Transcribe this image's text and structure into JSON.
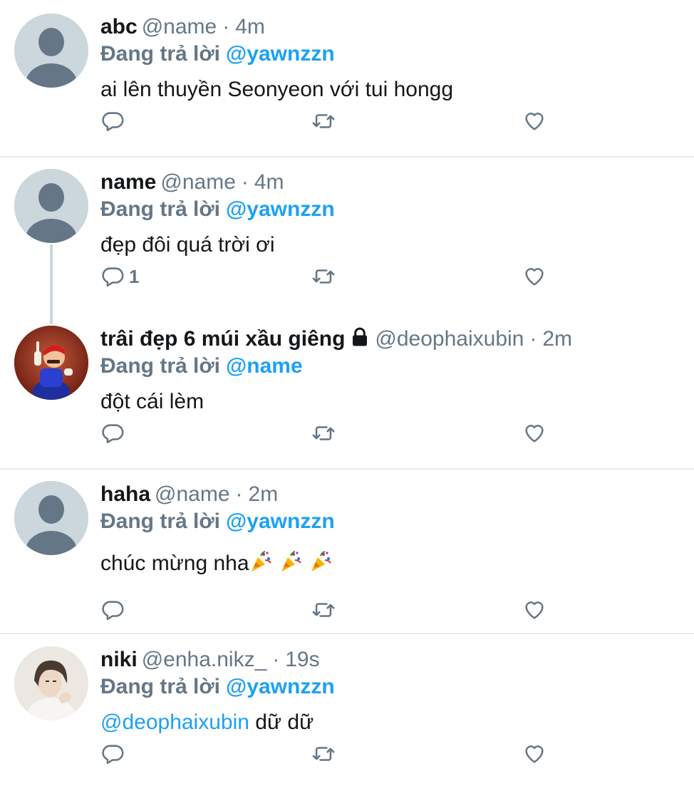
{
  "colors": {
    "link": "#1da1f2",
    "muted": "#657786",
    "divider": "#e6ecf0"
  },
  "tweets": [
    {
      "name": "abc",
      "handle": "@name",
      "sep": "·",
      "time": "4m",
      "replying_prefix": "Đang trả lời",
      "replying_to": "@yawnzzn",
      "text": "ai lên thuyền Seonyeon với tui hongg",
      "reply_count": "",
      "avatar": "default-avatar"
    },
    {
      "name": "name",
      "handle": "@name",
      "sep": "·",
      "time": "4m",
      "replying_prefix": "Đang trả lời",
      "replying_to": "@yawnzzn",
      "text": "đẹp đôi quá trời ơi",
      "reply_count": "1",
      "avatar": "default-avatar"
    },
    {
      "name": "trâi đẹp 6 múi xầu giêng",
      "handle": "@deophaixubin",
      "sep": "·",
      "time": "2m",
      "replying_prefix": "Đang trả lời",
      "replying_to": "@name",
      "text": "đột cái lèm",
      "reply_count": "",
      "avatar": "mario-photo",
      "icon": "lock-icon"
    },
    {
      "name": "haha",
      "handle": "@name",
      "sep": "·",
      "time": "2m",
      "replying_prefix": "Đang trả lời",
      "replying_to": "@yawnzzn",
      "text": "chúc mừng nha",
      "text_emoji": "party-popper-icon x3",
      "reply_count": "",
      "avatar": "default-avatar"
    },
    {
      "name": "niki",
      "handle": "@enha.nikz_",
      "sep": "·",
      "time": "19s",
      "replying_prefix": "Đang trả lời",
      "replying_to": "@yawnzzn",
      "text_mention": "@deophaixubin",
      "text": "dữ dữ",
      "reply_count": "",
      "avatar": "user-photo"
    }
  ]
}
